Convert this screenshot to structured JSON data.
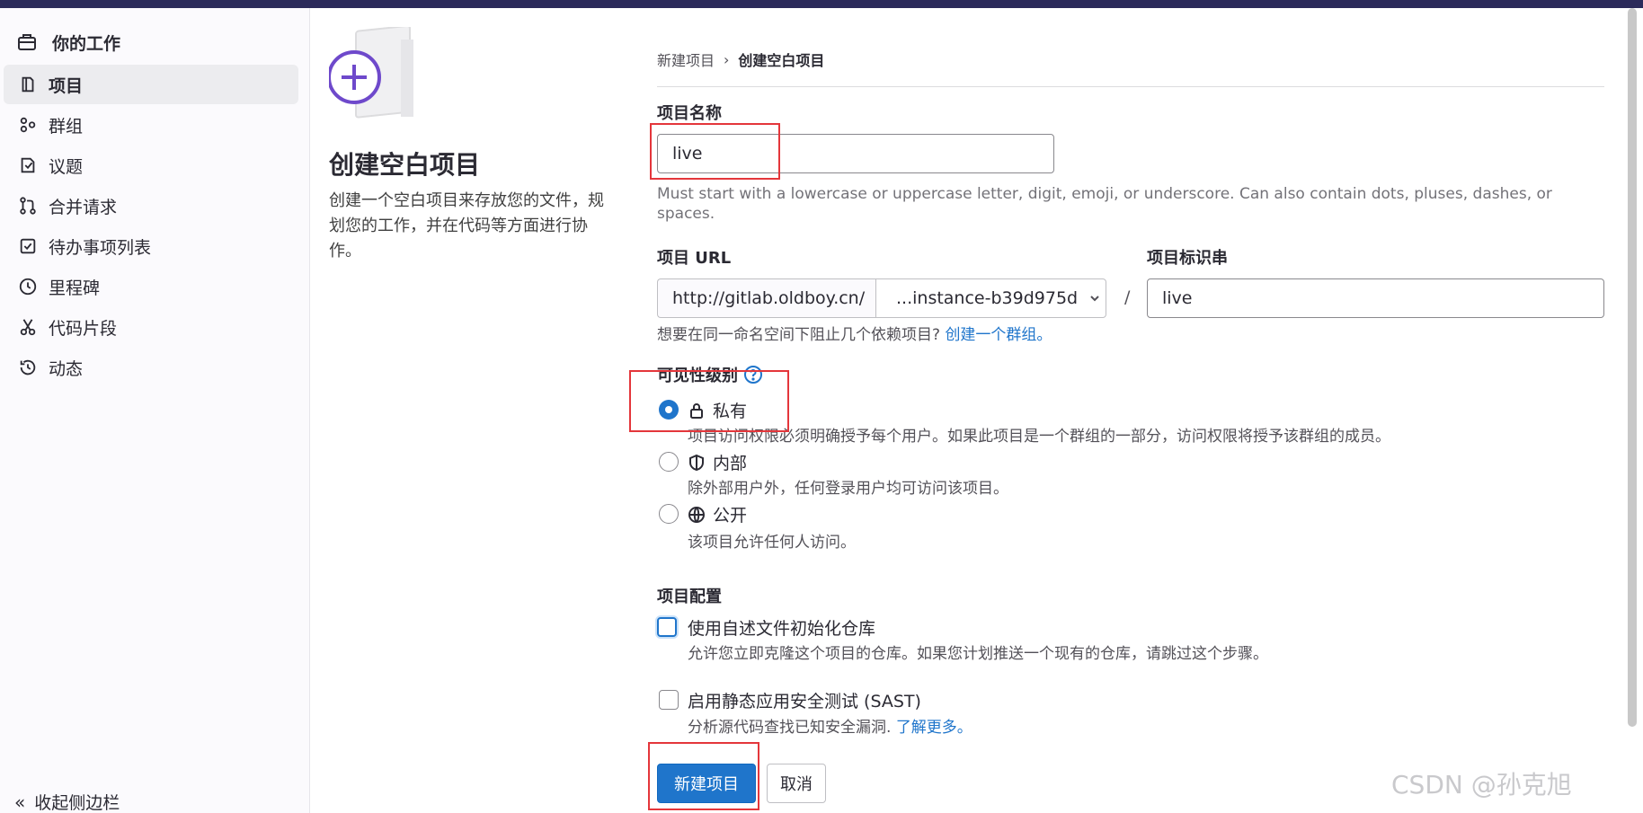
{
  "sidebar": {
    "header": "你的工作",
    "items": [
      {
        "label": "项目",
        "icon": "project-icon",
        "active": true
      },
      {
        "label": "群组",
        "icon": "group-icon"
      },
      {
        "label": "议题",
        "icon": "issues-icon"
      },
      {
        "label": "合并请求",
        "icon": "merge-request-icon"
      },
      {
        "label": "待办事项列表",
        "icon": "todo-icon"
      },
      {
        "label": "里程碑",
        "icon": "milestone-icon"
      },
      {
        "label": "代码片段",
        "icon": "snippet-icon"
      },
      {
        "label": "动态",
        "icon": "activity-icon"
      }
    ],
    "collapse_label": "收起侧边栏"
  },
  "intro": {
    "title": "创建空白项目",
    "description": "创建一个空白项目来存放您的文件，规划您的工作，并在代码等方面进行协作。"
  },
  "breadcrumb": {
    "parent": "新建项目",
    "current": "创建空白项目"
  },
  "form": {
    "project_name_label": "项目名称",
    "project_name_value": "live",
    "project_name_help": "Must start with a lowercase or uppercase letter, digit, emoji, or underscore. Can also contain dots, pluses, dashes, or spaces.",
    "project_url_label": "项目 URL",
    "url_prefix": "http://gitlab.oldboy.cn/",
    "namespace_value": "...instance-b39d975d",
    "slash": "/",
    "slug_label": "项目标识串",
    "slug_value": "live",
    "group_hint": "想要在同一命名空间下阻止几个依赖项目?",
    "group_link": "创建一个群组。",
    "visibility_label": "可见性级别",
    "visibility_options": [
      {
        "label": "私有",
        "desc": "项目访问权限必须明确授予每个用户。如果此项目是一个群组的一部分，访问权限将授予该群组的成员。",
        "icon": "lock-icon",
        "checked": true
      },
      {
        "label": "内部",
        "desc": "除外部用户外，任何登录用户均可访问该项目。",
        "icon": "shield-icon",
        "checked": false
      },
      {
        "label": "公开",
        "desc": "该项目允许任何人访问。",
        "icon": "globe-icon",
        "checked": false
      }
    ],
    "config_label": "项目配置",
    "init_readme_label": "使用自述文件初始化仓库",
    "init_readme_desc": "允许您立即克隆这个项目的仓库。如果您计划推送一个现有的仓库，请跳过这个步骤。",
    "sast_label": "启用静态应用安全测试 (SAST)",
    "sast_desc": "分析源代码查找已知安全漏洞.",
    "sast_link": "了解更多。",
    "create_button": "新建项目",
    "cancel_button": "取消"
  },
  "watermark": "CSDN @孙克旭",
  "colors": {
    "primary": "#1f75cb",
    "highlight_box": "#e4363b",
    "topbar": "#2b2a5a"
  }
}
